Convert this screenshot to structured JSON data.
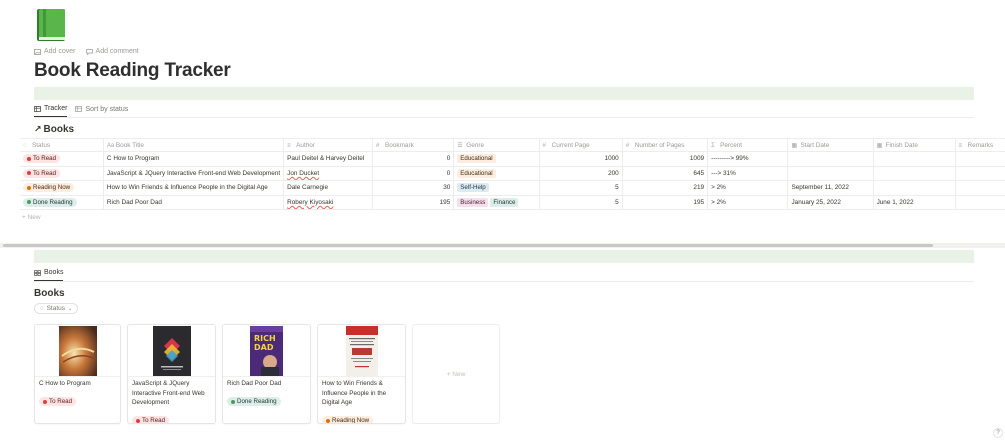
{
  "page": {
    "icon": "green-book-icon",
    "actions": {
      "add_cover": "Add cover",
      "add_comment": "Add comment"
    },
    "title": "Book Reading Tracker"
  },
  "colors": {
    "band": "#eaf1e7",
    "red": "#e03e3e",
    "red_bg": "#fbe4e4",
    "orange": "#d9730d",
    "orange_bg": "#fbeee0",
    "green": "#4d9a5f",
    "green_bg": "#ddedea",
    "blue_bg": "#ddebf1",
    "pink_bg": "#f4dfeb"
  },
  "view_tabs_top": [
    {
      "label": "Tracker",
      "icon": "table-icon",
      "active": true
    },
    {
      "label": "Sort by status",
      "icon": "table-icon",
      "active": false
    }
  ],
  "tracker": {
    "title": "Books",
    "columns": [
      {
        "label": "Status",
        "icon": "status-icon"
      },
      {
        "label": "Book Title",
        "icon": "title-icon"
      },
      {
        "label": "Author",
        "icon": "text-icon"
      },
      {
        "label": "Bookmark",
        "icon": "number-icon"
      },
      {
        "label": "Genre",
        "icon": "multiselect-icon"
      },
      {
        "label": "Current Page",
        "icon": "number-icon"
      },
      {
        "label": "Number of Pages",
        "icon": "number-icon"
      },
      {
        "label": "Percent",
        "icon": "formula-icon"
      },
      {
        "label": "Start Date",
        "icon": "calendar-icon"
      },
      {
        "label": "Finish Date",
        "icon": "calendar-icon"
      },
      {
        "label": "Remarks",
        "icon": "text-icon"
      }
    ],
    "rows": [
      {
        "status": "To Read",
        "title": "C How to Program",
        "author": "Paul Deitel & Harvey Deitel",
        "bookmark": "0",
        "genre": "Educational",
        "genre2": "",
        "current": "1000",
        "pages": "1009",
        "percent": "---------> 99%",
        "start": "",
        "finish": "",
        "remarks": ""
      },
      {
        "status": "To Read",
        "title": "JavaScript & JQuery Interactive Front-end Web Development",
        "author": "Jon Ducket",
        "bookmark": "0",
        "genre": "Educational",
        "genre2": "",
        "current": "200",
        "pages": "645",
        "percent": "---> 31%",
        "start": "",
        "finish": "",
        "remarks": ""
      },
      {
        "status": "Reading Now",
        "title": "How to Win Friends & Influence People in the Digital Age",
        "author": "Dale Carnegie",
        "bookmark": "30",
        "genre": "Self-Help",
        "genre2": "",
        "current": "5",
        "pages": "219",
        "percent": "> 2%",
        "start": "September 11, 2022",
        "finish": "",
        "remarks": ""
      },
      {
        "status": "Done Reading",
        "title": "Rich Dad Poor Dad",
        "author": "Robery Kiyosaki",
        "bookmark": "195",
        "genre": "Business",
        "genre2": "Finance",
        "current": "5",
        "pages": "195",
        "percent": "> 2%",
        "start": "January 25, 2022",
        "finish": "June 1, 2022",
        "remarks": ""
      }
    ],
    "new_label": "+ New"
  },
  "gallery": {
    "tab": {
      "label": "Books",
      "icon": "gallery-icon"
    },
    "title": "Books",
    "filter_label": "Status",
    "cards": [
      {
        "name": "C How to Program",
        "status": "To Read"
      },
      {
        "name": "JavaScript & JQuery Interactive Front-end Web Development",
        "status": "To Read"
      },
      {
        "name": "Rich Dad Poor Dad",
        "status": "Done Reading"
      },
      {
        "name": "How to Win Friends & Influence People in the Digital Age",
        "status": "Reading Now"
      }
    ],
    "new_label": "+ New"
  },
  "help": "?"
}
